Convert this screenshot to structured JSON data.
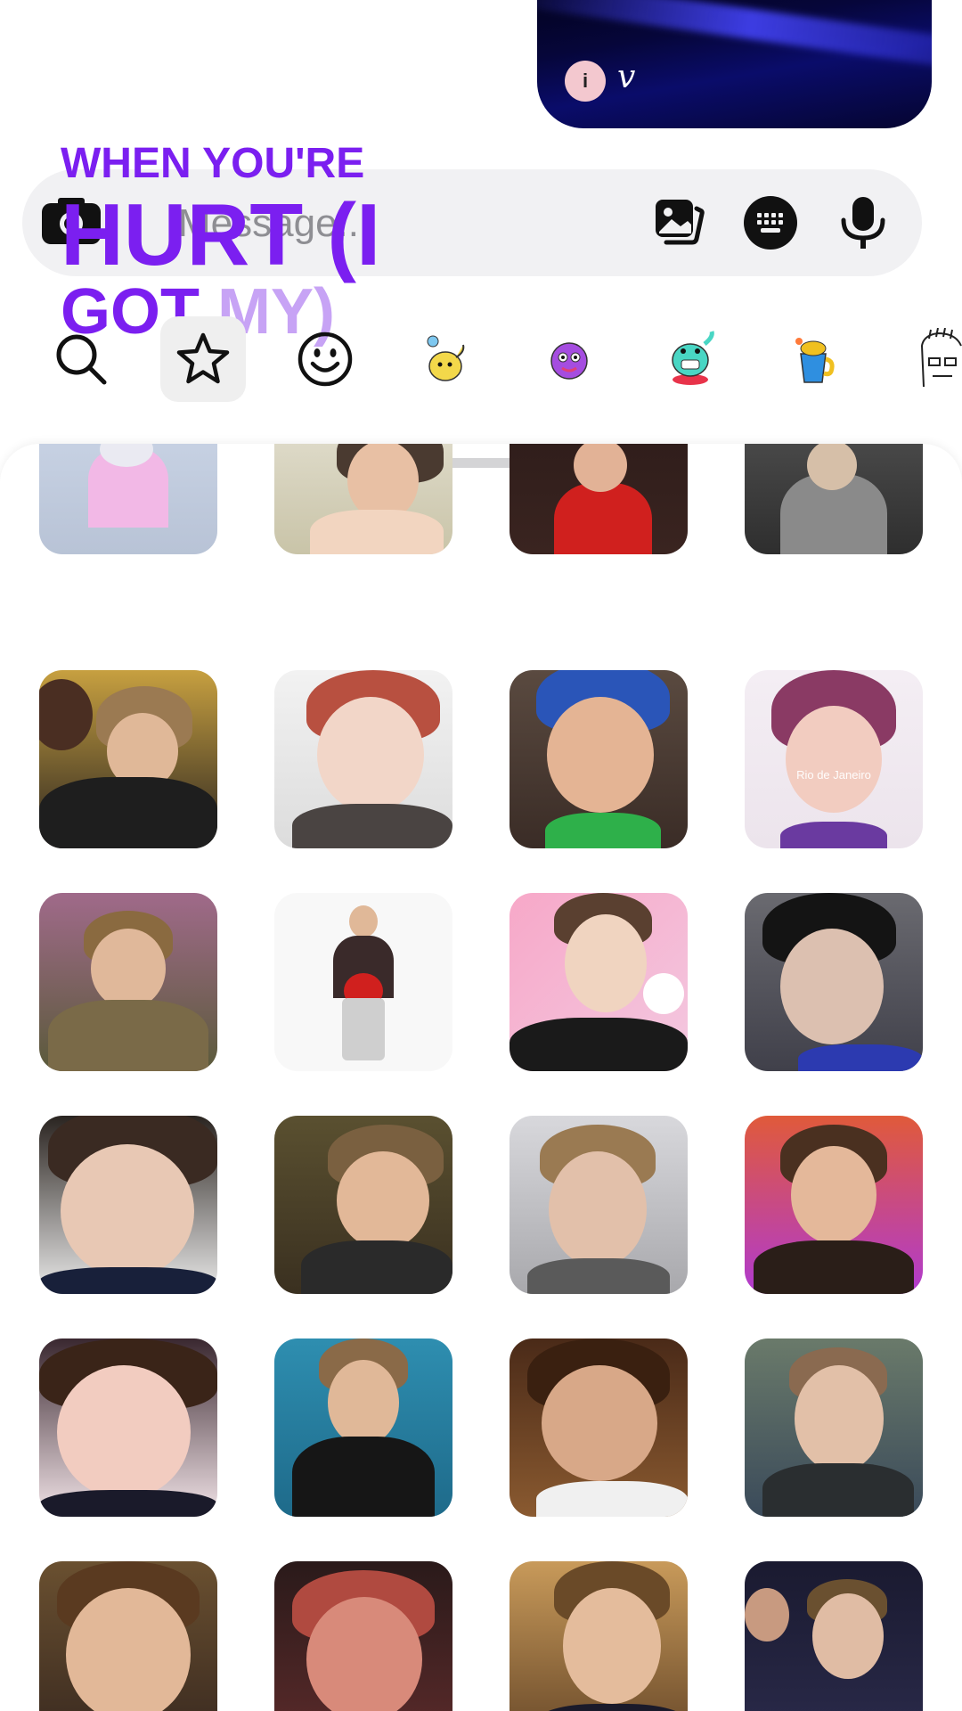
{
  "message": {
    "sender_avatar_letter": "i",
    "sender_initial": "v"
  },
  "composer": {
    "placeholder": "Message..."
  },
  "sticker_preview": {
    "line1": "WHEN YOU'RE",
    "line2": "HURT (I",
    "line3_part1": "GOT ",
    "line3_part2": "MY)"
  },
  "tabs": [
    {
      "name": "search-icon",
      "active": false
    },
    {
      "name": "star-icon",
      "active": true
    },
    {
      "name": "emoji-icon",
      "active": false
    },
    {
      "name": "sticker-pack-1",
      "active": false
    },
    {
      "name": "sticker-pack-2",
      "active": false
    },
    {
      "name": "sticker-pack-3",
      "active": false
    },
    {
      "name": "sticker-pack-4",
      "active": false
    },
    {
      "name": "sticker-pack-5",
      "active": false
    }
  ],
  "sticker_grid": {
    "captions": {
      "r1c4": "Rio de Janeiro"
    }
  },
  "colors": {
    "accent_text": "#7b1ff0",
    "composer_bg": "#f1f1f3",
    "active_tab_bg": "#efefef"
  }
}
